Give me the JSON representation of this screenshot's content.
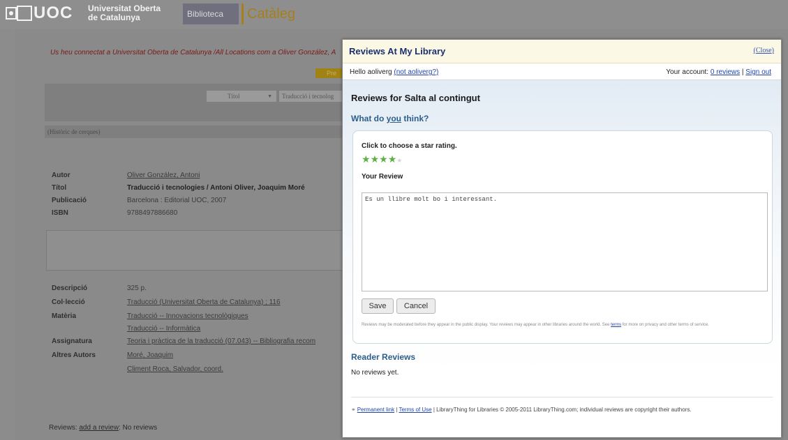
{
  "header": {
    "logo_text": "UOC",
    "university_name_line1": "Universitat Oberta",
    "university_name_line2": "de Catalunya",
    "nav_biblioteca": "Biblioteca",
    "nav_cataleg": "Catàleg"
  },
  "catalog": {
    "login_message": "Us heu connectat a Universitat Oberta de Catalunya /All Locations com a Oliver González, A",
    "search_button": "Pre",
    "search_field_select": "Títol",
    "search_field_value": "Traducció i tecnolog",
    "history_label": "(Històric de cerques)",
    "record": [
      {
        "label": "Autor",
        "value": "Oliver González, Antoni"
      },
      {
        "label": "Títol",
        "value": "Traducció i tecnologies / Antoni Oliver, Joaquim Moré"
      },
      {
        "label": "Publicació",
        "value": "Barcelona : Editorial UOC, 2007"
      },
      {
        "label": "ISBN",
        "value": "9788497886680"
      }
    ],
    "details": [
      {
        "label": "Descripció",
        "value": "325 p."
      },
      {
        "label": "Col·lecció",
        "value": "Traducció (Universitat Oberta de Catalunya) ; 116"
      },
      {
        "label": "Matèria",
        "value": "Traducció -- Innovacions tecnològiques"
      },
      {
        "label": "",
        "value": "Traducció -- Informàtica"
      },
      {
        "label": "Assignatura",
        "value": "Teoria i pràctica de la traducció (07.043) -- Bibliografia recom"
      },
      {
        "label": "Altres Autors",
        "value": "Moré, Joaquim"
      },
      {
        "label": "",
        "value": "Climent Roca, Salvador, coord."
      }
    ],
    "reviews_label": "Reviews:",
    "add_review_link": "add a review",
    "reviews_status": ": No reviews"
  },
  "modal": {
    "title": "Reviews At My Library",
    "close": "(Close)",
    "hello_prefix": "Hello aoliverg",
    "not_user_link": "(not aoliverg?)",
    "account_prefix": "Your account:",
    "reviews_count_link": "0 reviews",
    "separator": "|",
    "sign_out": "Sign out",
    "reviews_for": "Reviews for Salta al contingut",
    "what_do": "What do",
    "you": "you",
    "think": "think?",
    "click_star": "Click to choose a star rating.",
    "rating": {
      "value": 4,
      "max": 5
    },
    "your_review": "Your Review",
    "review_text": "Es un llibre molt bo i interessant.",
    "save": "Save",
    "cancel": "Cancel",
    "fine_print_1": "Reviews may be moderated before they appear in the public display. Your reviews may appear in other libraries around the world. See",
    "terms_link": "terms",
    "fine_print_2": "for more on privacy and other terms of service.",
    "reader_reviews": "Reader Reviews",
    "no_reviews": "No reviews yet.",
    "footer": {
      "permanent_link": "Permanent link",
      "sep1": "|",
      "terms_of_use": "Terms of Use",
      "rest": "| LibraryThing for Libraries © 2005-2011 LibraryThing.com; individual reviews are copyright their authors."
    }
  },
  "colors": {
    "accent_title": "#1c2f6e",
    "section_heading": "#2b5e8c",
    "star_on": "#5db043",
    "link": "#2244aa"
  },
  "icons": [
    "uoc-logo-icon",
    "select-arrow-icon",
    "star-icon",
    "chain-link-icon"
  ]
}
